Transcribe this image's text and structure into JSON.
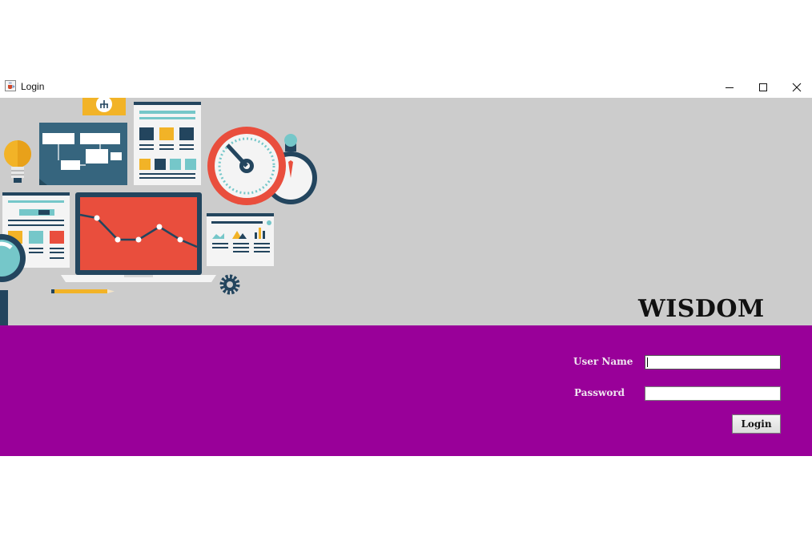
{
  "window": {
    "title": "Login",
    "icon": "java-cup-icon",
    "controls": [
      "minimize-icon",
      "maximize-icon",
      "close-icon"
    ]
  },
  "banner": {
    "brand": "WISDOM",
    "background": "#cccccc"
  },
  "form": {
    "background": "#990099",
    "username_label": "User Name",
    "username_value": "",
    "password_label": "Password",
    "password_value": "",
    "login_label": "Login"
  }
}
